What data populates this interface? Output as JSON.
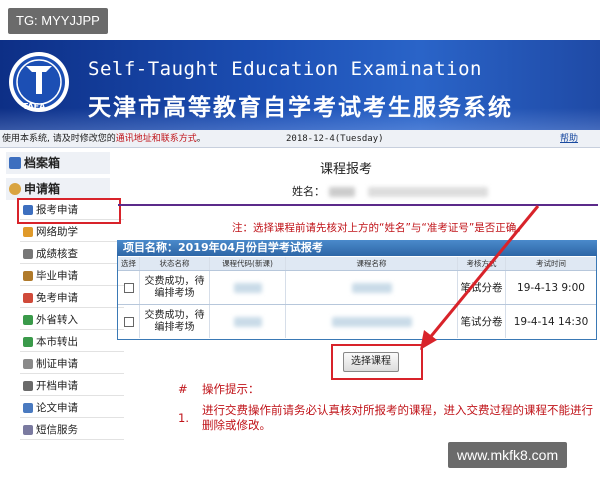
{
  "watermark_top": "TG: MYYJJPP",
  "watermark_bottom": "www.mkfk8.com",
  "banner": {
    "title_en": "Self-Taught Education Examination",
    "title_cn": "天津市高等教育自学考试考生服务系统",
    "logo_text": "TAEA"
  },
  "strip": {
    "notice_prefix": "使用本系统, 请及时修改您的",
    "notice_link": "通讯地址和联系方式",
    "notice_suffix": "。",
    "date": "2018-12-4(Tuesday)",
    "help": "帮助"
  },
  "sidebar": {
    "group1": "档案箱",
    "group2": "申请箱",
    "items": [
      {
        "label": "报考申请",
        "color": "#3d6fbf"
      },
      {
        "label": "网络助学",
        "color": "#e09a2a"
      },
      {
        "label": "成绩核查",
        "color": "#777777"
      },
      {
        "label": "毕业申请",
        "color": "#b07a2a"
      },
      {
        "label": "免考申请",
        "color": "#d04a3a"
      },
      {
        "label": "外省转入",
        "color": "#3a9a4a"
      },
      {
        "label": "本市转出",
        "color": "#3a9a4a"
      },
      {
        "label": "制证申请",
        "color": "#8a8a8a"
      },
      {
        "label": "开档申请",
        "color": "#6a6a6a"
      },
      {
        "label": "论文申请",
        "color": "#4a7ac0"
      },
      {
        "label": "短信服务",
        "color": "#7a7aa0"
      }
    ]
  },
  "main": {
    "title": "课程报考",
    "name_label": "姓名：",
    "note": "注：选择课程前请先核对上方的“姓名”与“准考证号”是否正确。",
    "project": "项目名称：2019年04月份自学考试报考",
    "columns": [
      "选择",
      "状态名称",
      "课程代码(新课)",
      "课程名称",
      "考核方式",
      "考试时间"
    ],
    "rows": [
      {
        "status": "交费成功，待编排考场",
        "method": "笔试分卷",
        "time": "19-4-13 9:00"
      },
      {
        "status": "交费成功，待编排考场",
        "method": "笔试分卷",
        "time": "19-4-14 14:30"
      }
    ],
    "select_button": "选择课程"
  },
  "tips": {
    "hash": "#",
    "heading": "操作提示：",
    "num": "1.",
    "text": "进行交费操作前请务必认真核对所报考的课程，进入交费过程的课程不能进行删除或修改。"
  },
  "colors": {
    "accent_red": "#d8232a",
    "banner_blue": "#1c4fb4",
    "header_blue": "#2e66a6"
  }
}
